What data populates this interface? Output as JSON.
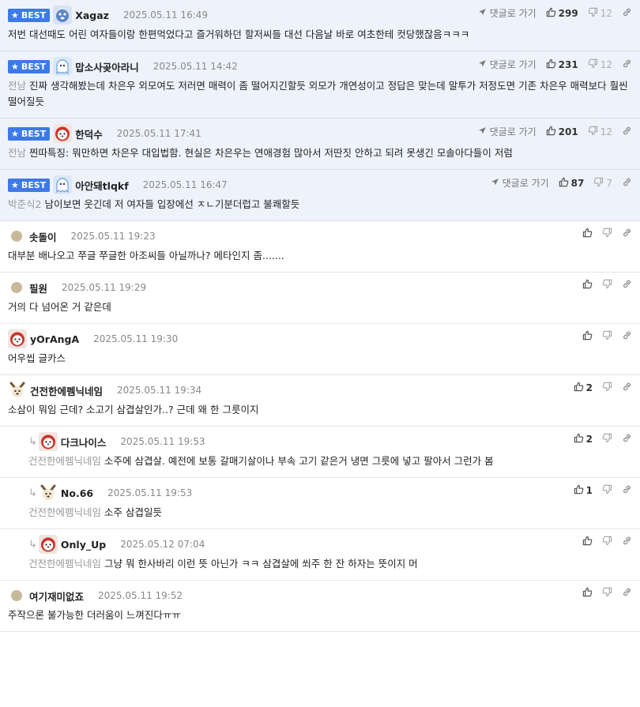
{
  "labels": {
    "best": "BEST",
    "goto": "댓글로 가기"
  },
  "comments": [
    {
      "best": true,
      "nick": "Xagaz",
      "date": "2025.05.11 16:49",
      "reply_to": "",
      "text": "저번 대선때도 어린 여자들이랑 한편먹었다고 즐거워하던 할저씨들 대선 다음날 바로 여초한테 컷당했잖음ㅋㅋㅋ",
      "likes": "299",
      "dislikes": "12",
      "avatar": "blue-dog"
    },
    {
      "best": true,
      "nick": "맙소사곶아라니",
      "date": "2025.05.11 14:42",
      "reply_to": "전남",
      "text": "진짜 생각해봤는데 차은우 외모여도 저러면 매력이 좀 떨어지긴할듯 외모가 개연성이고 정답은 맞는데 말투가 저정도면 기존 차은우 매력보다 훨씬 떨어질듯",
      "likes": "231",
      "dislikes": "12",
      "avatar": "blue-ghost"
    },
    {
      "best": true,
      "nick": "한덕수",
      "date": "2025.05.11 17:41",
      "reply_to": "전남",
      "text": "찐따특징: 뭐만하면 차은우 대입법함. 현실은 차은우는 연애경험 많아서 저딴짓 안하고 되려 못생긴 모솔아다들이 저럼",
      "likes": "201",
      "dislikes": "12",
      "avatar": "red-face"
    },
    {
      "best": true,
      "nick": "아안돼tlqkf",
      "date": "2025.05.11 16:47",
      "reply_to": "박준식2",
      "text": "남이보면 웃긴데 저 여자들 입장에선 ㅈㄴ기분더럽고 불쾌할듯",
      "likes": "87",
      "dislikes": "7",
      "avatar": "blue-ghost"
    },
    {
      "best": false,
      "reply": false,
      "nick": "솟돌이",
      "date": "2025.05.11 19:23",
      "reply_to": "",
      "text": "대부분 배나오고 쭈글 쭈글한 아조씨들 아닐까나? 메타인지 좀.......",
      "likes": "",
      "dislikes": "",
      "avatar": "dot"
    },
    {
      "best": false,
      "reply": false,
      "nick": "필원",
      "date": "2025.05.11 19:29",
      "reply_to": "",
      "text": "거의 다 넘어온 거 같은데",
      "likes": "",
      "dislikes": "",
      "avatar": "dot"
    },
    {
      "best": false,
      "reply": false,
      "nick": "yOrAngA",
      "date": "2025.05.11 19:30",
      "reply_to": "",
      "text": "어우씹 글카스",
      "likes": "",
      "dislikes": "",
      "avatar": "red-face"
    },
    {
      "best": false,
      "reply": false,
      "nick": "건전한에펨닉네임",
      "date": "2025.05.11 19:34",
      "reply_to": "",
      "text": "소삼이 뭐임 근데? 소고기 삼겹살인가..? 근데 왜 한 그릇이지",
      "likes": "2",
      "dislikes": "",
      "avatar": "dog"
    },
    {
      "best": false,
      "reply": true,
      "nick": "다크나이스",
      "date": "2025.05.11 19:53",
      "reply_to": "건전한에펨닉네임",
      "text": "소주에 삼겹살. 예전에 보통 갈매기살이나 부속 고기 같은거 냉면 그릇에 넣고 팔아서 그런가 봄",
      "likes": "2",
      "dislikes": "",
      "avatar": "red-face"
    },
    {
      "best": false,
      "reply": true,
      "nick": "No.66",
      "date": "2025.05.11 19:53",
      "reply_to": "건전한에펨닉네임",
      "text": "소주 삼겹일듯",
      "likes": "1",
      "dislikes": "",
      "avatar": "dog"
    },
    {
      "best": false,
      "reply": true,
      "nick": "Only_Up",
      "date": "2025.05.12 07:04",
      "reply_to": "건전한에펨닉네임",
      "text": "그냥 뭐 한사바리 이런 뜻 아닌가 ㅋㅋ 삼겹살에 쐬주 한 잔 하자는 뜻이지 머",
      "likes": "",
      "dislikes": "",
      "avatar": "red-face"
    },
    {
      "best": false,
      "reply": false,
      "nick": "여기재미없죠",
      "date": "2025.05.11 19:52",
      "reply_to": "",
      "text": "주작으론 불가능한 더러움이 느껴진다ㅠㅠ",
      "likes": "",
      "dislikes": "",
      "avatar": "dot"
    }
  ]
}
